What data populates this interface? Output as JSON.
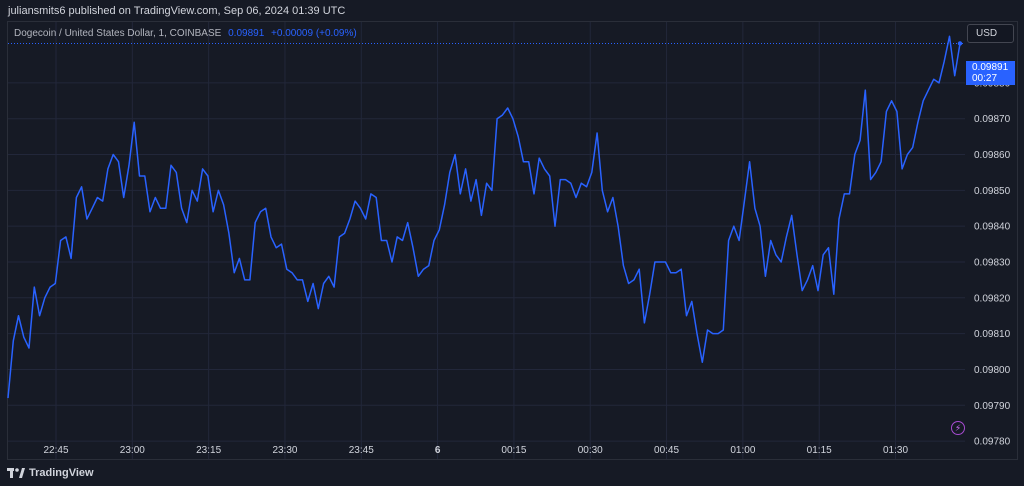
{
  "header": {
    "publisher_text": "juliansmits6 published on TradingView.com, Sep 06, 2024 01:39 UTC"
  },
  "legend": {
    "symbol": "Dogecoin / United States Dollar, 1, COINBASE",
    "last_value": "0.09891",
    "change": "+0.00009 (+0.09%)"
  },
  "currency_button": "USD",
  "last_price_badge": {
    "price": "0.09891",
    "countdown": "00:27"
  },
  "brand_label": "TradingView",
  "icons": {
    "bolt": "bolt-icon",
    "logo": "tradingview-logo-icon"
  },
  "colors": {
    "background": "#161a25",
    "line": "#2962ff",
    "grid": "#22273a",
    "text": "#d1d4dc"
  },
  "chart_data": {
    "type": "line",
    "title": "",
    "xlabel": "",
    "ylabel": "",
    "grid": true,
    "ylim": [
      0.09775,
      0.09897
    ],
    "xlim_minutes": [
      1345,
      1421
    ],
    "y_ticks": [
      "0.09780",
      "0.09790",
      "0.09800",
      "0.09810",
      "0.09820",
      "0.09830",
      "0.09840",
      "0.09850",
      "0.09860",
      "0.09870",
      "0.09880"
    ],
    "x_ticks": [
      {
        "label": "22:45",
        "minute": 1365
      },
      {
        "label": "23:00",
        "minute": 1380
      },
      {
        "label": "23:15",
        "minute": 1395
      },
      {
        "label": "23:30",
        "minute": 1410
      },
      {
        "label": "23:45",
        "minute": 1425
      },
      {
        "label": "6",
        "minute": 1440,
        "bold": true
      },
      {
        "label": "00:15",
        "minute": 1455
      },
      {
        "label": "00:30",
        "minute": 1470
      },
      {
        "label": "00:45",
        "minute": 1485
      },
      {
        "label": "01:00",
        "minute": 1500
      },
      {
        "label": "01:15",
        "minute": 1515
      },
      {
        "label": "01:30",
        "minute": 1530
      }
    ],
    "series": [
      {
        "values": [
          0.09792,
          0.09808,
          0.09815,
          0.09809,
          0.09806,
          0.09823,
          0.09815,
          0.0982,
          0.09823,
          0.09824,
          0.09836,
          0.09837,
          0.09831,
          0.09848,
          0.09851,
          0.09842,
          0.09845,
          0.09848,
          0.09847,
          0.09856,
          0.0986,
          0.09858,
          0.09848,
          0.09857,
          0.09869,
          0.09854,
          0.09854,
          0.09844,
          0.09848,
          0.09845,
          0.09845,
          0.09857,
          0.09855,
          0.09845,
          0.09841,
          0.0985,
          0.09847,
          0.09856,
          0.09854,
          0.09844,
          0.0985,
          0.09846,
          0.09838,
          0.09827,
          0.09831,
          0.09825,
          0.09825,
          0.09841,
          0.09844,
          0.09845,
          0.09837,
          0.09834,
          0.09835,
          0.09828,
          0.09827,
          0.09825,
          0.09825,
          0.09819,
          0.09824,
          0.09817,
          0.09824,
          0.09826,
          0.09823,
          0.09837,
          0.09838,
          0.09842,
          0.09847,
          0.09845,
          0.09842,
          0.09849,
          0.09848,
          0.09836,
          0.09836,
          0.0983,
          0.09837,
          0.09836,
          0.09841,
          0.09834,
          0.09826,
          0.09828,
          0.09829,
          0.09836,
          0.09839,
          0.09846,
          0.09855,
          0.0986,
          0.09849,
          0.09856,
          0.09847,
          0.09853,
          0.09843,
          0.09852,
          0.0985,
          0.0987,
          0.09871,
          0.09873,
          0.0987,
          0.09865,
          0.09858,
          0.09858,
          0.09849,
          0.09859,
          0.09856,
          0.09854,
          0.0984,
          0.09853,
          0.09853,
          0.09852,
          0.09848,
          0.09852,
          0.09851,
          0.09855,
          0.09866,
          0.0985,
          0.09844,
          0.09848,
          0.0984,
          0.09829,
          0.09824,
          0.09825,
          0.09828,
          0.09813,
          0.09821,
          0.0983,
          0.0983,
          0.0983,
          0.09827,
          0.09827,
          0.09828,
          0.09815,
          0.09819,
          0.0981,
          0.09802,
          0.09811,
          0.0981,
          0.0981,
          0.09811,
          0.09836,
          0.0984,
          0.09836,
          0.09847,
          0.09858,
          0.09845,
          0.0984,
          0.09826,
          0.09836,
          0.09832,
          0.0983,
          0.09837,
          0.09843,
          0.09832,
          0.09822,
          0.09825,
          0.09829,
          0.09822,
          0.09832,
          0.09834,
          0.09821,
          0.09842,
          0.09849,
          0.09849,
          0.0986,
          0.09864,
          0.09878,
          0.09853,
          0.09855,
          0.09858,
          0.09872,
          0.09875,
          0.09872,
          0.09856,
          0.0986,
          0.09862,
          0.09869,
          0.09875,
          0.09878,
          0.09881,
          0.0988,
          0.09886,
          0.09893,
          0.09882,
          0.09891
        ]
      }
    ],
    "last_value": 0.09891
  }
}
